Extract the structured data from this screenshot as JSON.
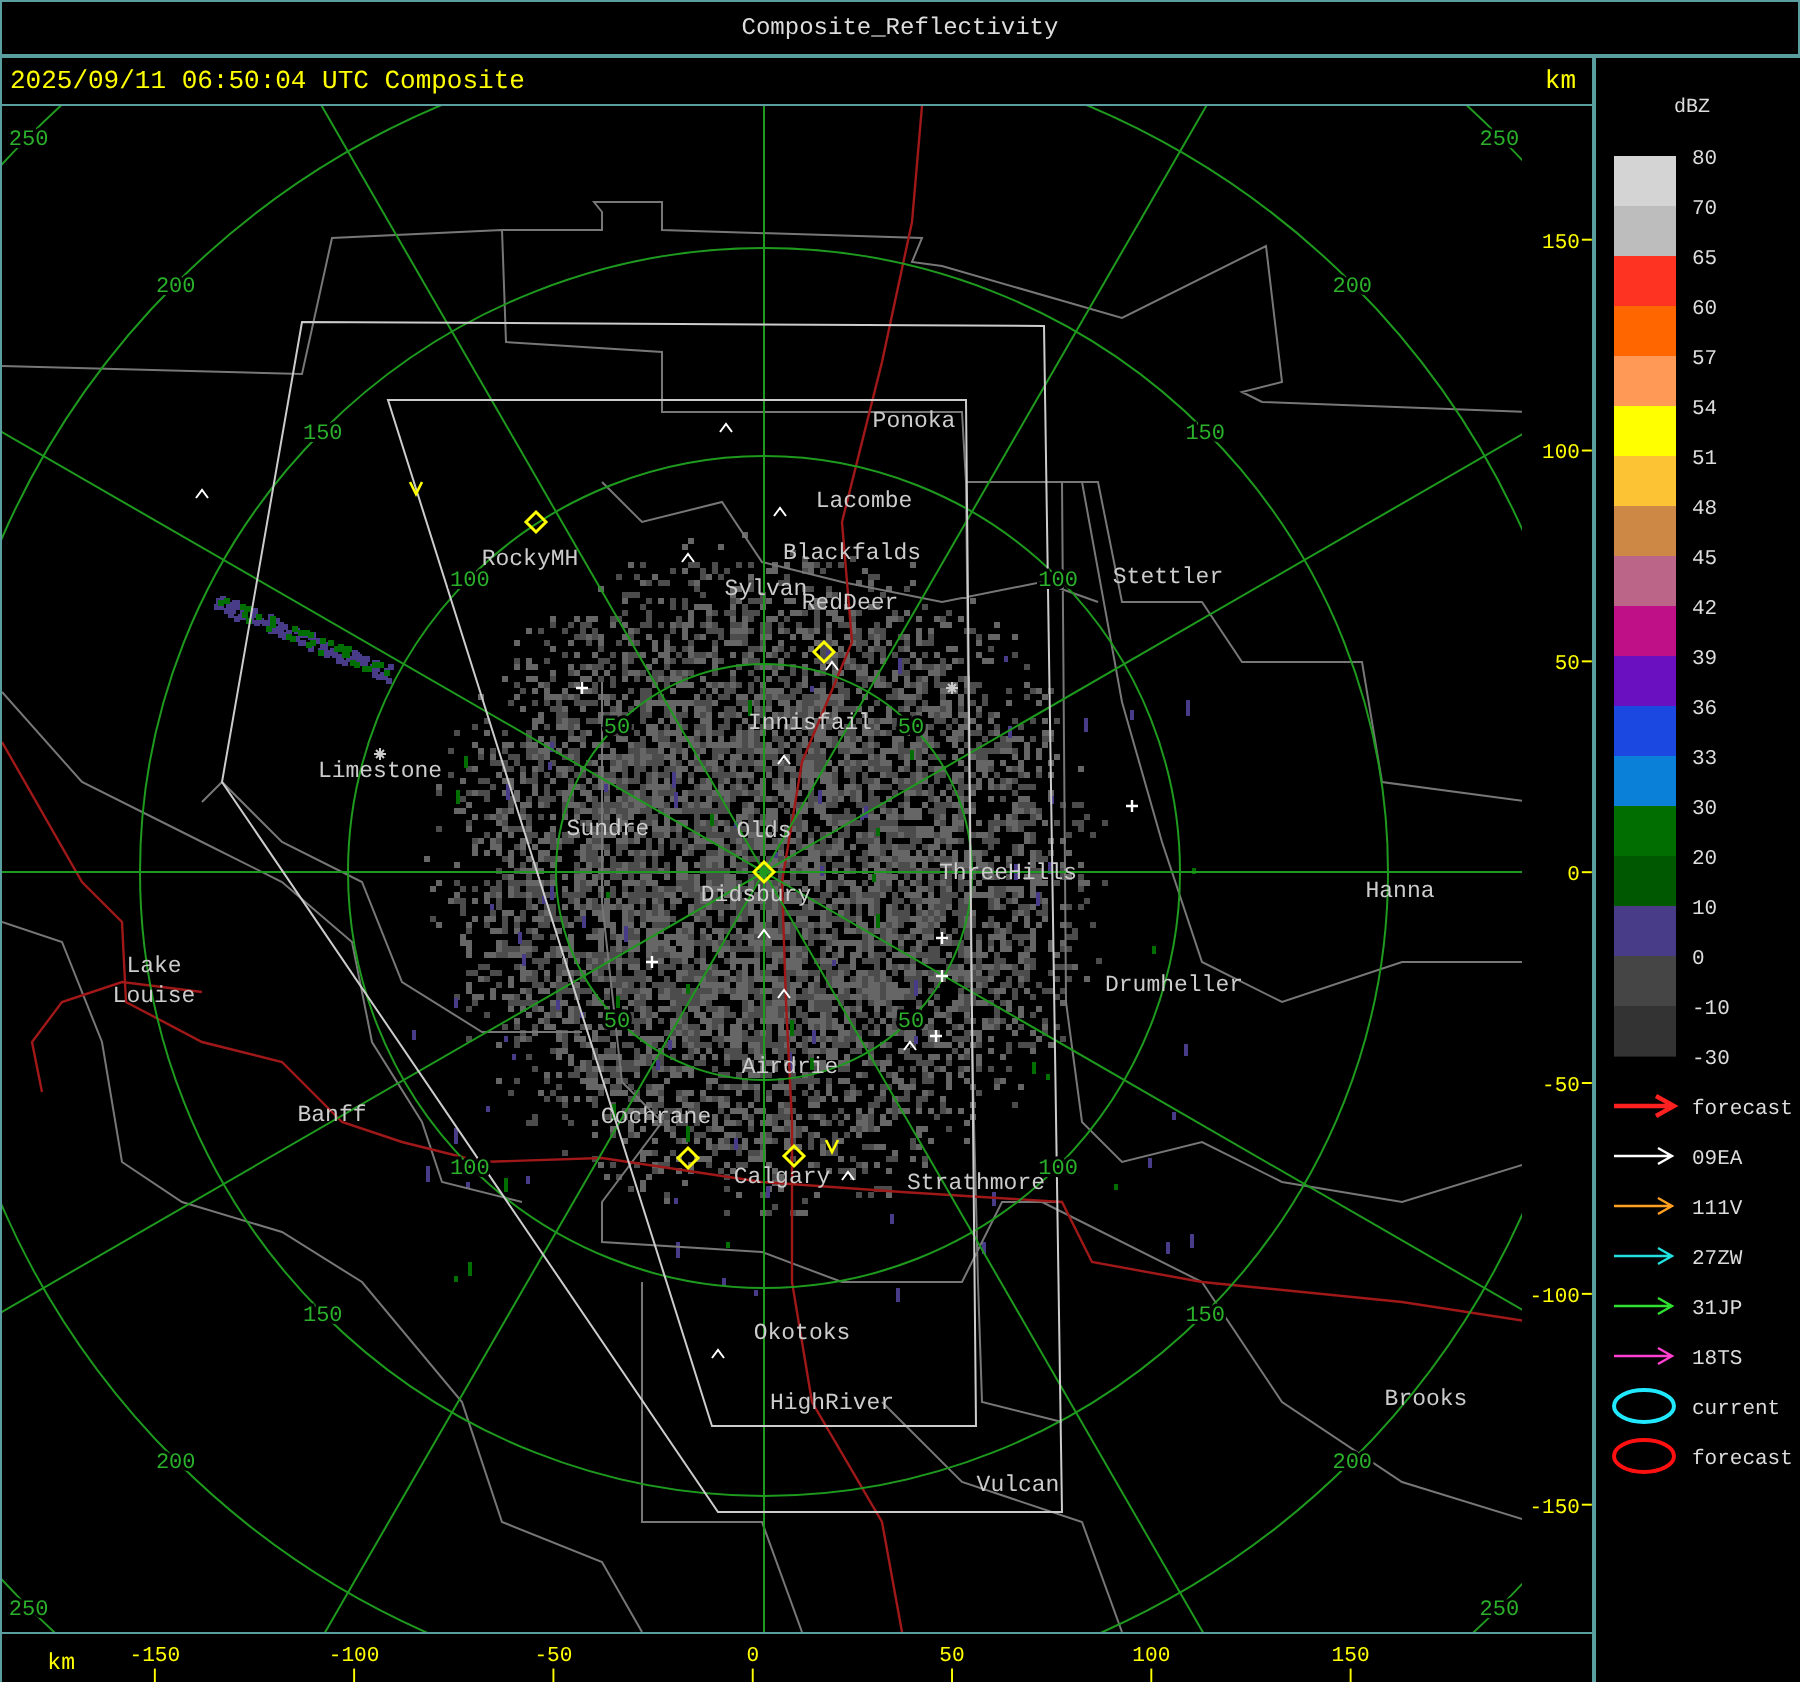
{
  "title_bar": {
    "title": "Composite_Reflectivity"
  },
  "header": {
    "timestamp": "2025/09/11 06:50:04 UTC Composite",
    "unit": "km"
  },
  "map": {
    "range_rings": [
      {
        "labels": [
          "50",
          "50",
          "50",
          "50"
        ]
      },
      {
        "labels": [
          "100",
          "100",
          "100",
          "100"
        ]
      },
      {
        "labels": [
          "150",
          "150",
          "150",
          "150"
        ]
      },
      {
        "labels": [
          "200",
          "200",
          "200",
          "200"
        ]
      },
      {
        "labels": [
          "250",
          "250",
          "250",
          "250"
        ]
      }
    ],
    "towns": [
      {
        "name": "Ponoka"
      },
      {
        "name": "Lacombe"
      },
      {
        "name": "Blackfalds"
      },
      {
        "name": "Stettler"
      },
      {
        "name": "RockyMH"
      },
      {
        "name": "Sylvan"
      },
      {
        "name": "RedDeer"
      },
      {
        "name": "Innisfail"
      },
      {
        "name": "Limestone"
      },
      {
        "name": "Sundre"
      },
      {
        "name": "Olds"
      },
      {
        "name": "Didsbury"
      },
      {
        "name": "ThreeHills"
      },
      {
        "name": "Hanna"
      },
      {
        "name": "Lake Louise"
      },
      {
        "name": "Drumheller"
      },
      {
        "name": "Airdrie"
      },
      {
        "name": "Banff"
      },
      {
        "name": "Cochrane"
      },
      {
        "name": "Calgary"
      },
      {
        "name": "Strathmore"
      },
      {
        "name": "Okotoks"
      },
      {
        "name": "HighRiver"
      },
      {
        "name": "Brooks"
      },
      {
        "name": "Vulcan"
      }
    ]
  },
  "y_axis": {
    "ticks": [
      "150",
      "100",
      "50",
      "0",
      "-50",
      "-100",
      "-150"
    ]
  },
  "x_axis": {
    "unit": "km",
    "ticks": [
      "-150",
      "-100",
      "-50",
      "0",
      "50",
      "100",
      "150"
    ]
  },
  "legend": {
    "title": "dBZ",
    "bands": [
      {
        "color": "#d4d4d4"
      },
      {
        "color": "#bdbdbd"
      },
      {
        "color": "#ff3322"
      },
      {
        "color": "#ff6600"
      },
      {
        "color": "#ff9955"
      },
      {
        "color": "#ffff00"
      },
      {
        "color": "#fcc434"
      },
      {
        "color": "#cc8844"
      },
      {
        "color": "#bb6688"
      },
      {
        "color": "#c01088"
      },
      {
        "color": "#6a10c0"
      },
      {
        "color": "#1a48e0"
      },
      {
        "color": "#0a80d8"
      },
      {
        "color": "#006e00"
      },
      {
        "color": "#005800"
      },
      {
        "color": "#483c88"
      },
      {
        "color": "#454545"
      },
      {
        "color": "#333333"
      }
    ],
    "labels": [
      "80",
      "70",
      "65",
      "60",
      "57",
      "54",
      "51",
      "48",
      "45",
      "42",
      "39",
      "36",
      "33",
      "30",
      "20",
      "10",
      "0",
      "-10",
      "-30"
    ],
    "tracks": [
      {
        "kind": "big_arrow",
        "color": "#ff2020",
        "label": "forecast"
      },
      {
        "kind": "arrow",
        "color": "#ffffff",
        "label": "09EA"
      },
      {
        "kind": "arrow",
        "color": "#ffa020",
        "label": "111V"
      },
      {
        "kind": "arrow",
        "color": "#20e0e0",
        "label": "27ZW"
      },
      {
        "kind": "arrow",
        "color": "#30e030",
        "label": "31JP"
      },
      {
        "kind": "arrow",
        "color": "#ff40d0",
        "label": "18TS"
      },
      {
        "kind": "ellipse",
        "color": "#20e8ff",
        "label": "current"
      },
      {
        "kind": "ellipse",
        "color": "#ff1010",
        "label": "forecast"
      }
    ]
  }
}
